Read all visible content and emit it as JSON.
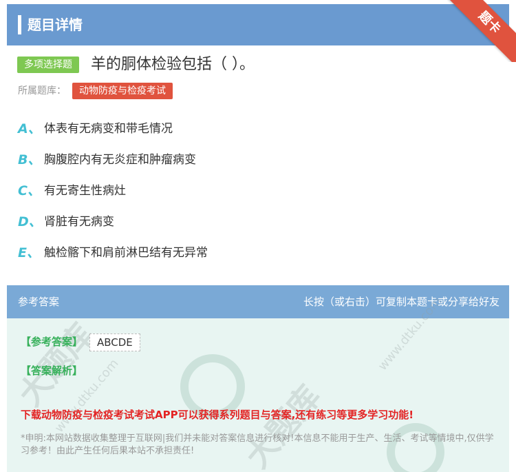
{
  "header": {
    "title": "题目详情",
    "corner_ribbon": "题卡"
  },
  "question": {
    "type_tag": "多项选择题",
    "text": "羊的胴体检验包括（ ）。",
    "bank_label": "所属题库：",
    "bank_name": "动物防疫与检疫考试"
  },
  "options": [
    {
      "letter": "A、",
      "text": "体表有无病变和带毛情况"
    },
    {
      "letter": "B、",
      "text": "胸腹腔内有无炎症和肿瘤病变"
    },
    {
      "letter": "C、",
      "text": "有无寄生性病灶"
    },
    {
      "letter": "D、",
      "text": "肾脏有无病变"
    },
    {
      "letter": "E、",
      "text": "触检髂下和肩前淋巴结有无异常"
    }
  ],
  "answer_section": {
    "title": "参考答案",
    "hint": "长按（或右击）可复制本题卡或分享给好友",
    "answer_label": "【参考答案】",
    "answer_value": "ABCDE",
    "analysis_label": "【答案解析】",
    "promo": "下载动物防疫与检疫考试考试APP可以获得系列题目与答案,还有练习等更多学习功能!",
    "disclaimer": "*申明:本网站数据收集整理于互联网|我们并未能对答案信息进行核对!本信息不能用于生产、生活、考试等情境中,仅供学习参考！由此产生任何后果本站不承担责任!"
  },
  "watermark": {
    "text": "大题库",
    "url": "www.dtku.com"
  },
  "colors": {
    "header_bg": "#6a9ad0",
    "ribbon": "#e0533e",
    "type_tag": "#7ec852",
    "bank_tag": "#e0533e",
    "option_letter": "#43bfd3",
    "answer_bg": "#e8f5f2",
    "answer_head": "#7aa9d6",
    "answer_label": "#36b05a",
    "promo": "#e32424"
  }
}
